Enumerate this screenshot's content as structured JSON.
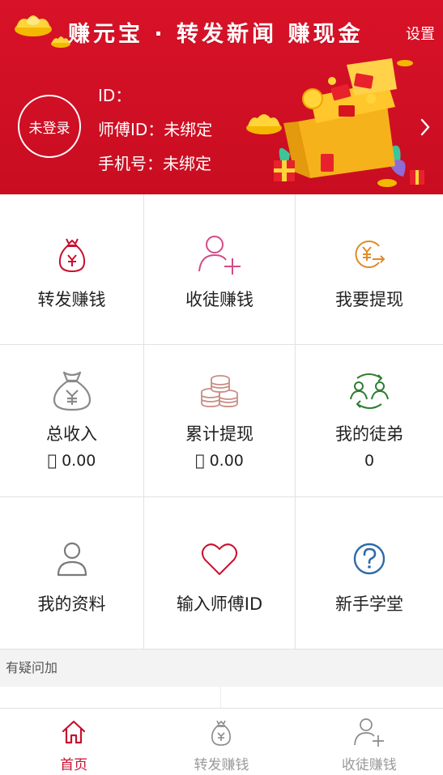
{
  "header": {
    "slogan": "赚元宝 · 转发新闻 赚现金",
    "settings_label": "设置",
    "avatar_label": "未登录",
    "id_line": "ID：",
    "master_id_line": "师傅ID：未绑定",
    "phone_line": "手机号：未绑定",
    "accent_color": "#d81228"
  },
  "grid": {
    "share_earn": {
      "label": "转发赚钱",
      "icon": "money-bag-icon"
    },
    "recruit_earn": {
      "label": "收徒赚钱",
      "icon": "add-user-icon"
    },
    "withdraw": {
      "label": "我要提现",
      "icon": "yuan-transfer-icon"
    },
    "total_income": {
      "label": "总收入",
      "value": "\u0000 0.00",
      "icon": "money-sack-icon"
    },
    "total_withdrawn": {
      "label": "累计提现",
      "value": "\u0000 0.00",
      "icon": "coin-stack-icon"
    },
    "my_apprentices": {
      "label": "我的徒弟",
      "value": "0",
      "icon": "people-exchange-icon"
    },
    "my_profile": {
      "label": "我的资料",
      "icon": "user-icon"
    },
    "enter_master_id": {
      "label": "输入师傅ID",
      "icon": "heart-icon"
    },
    "beginner_school": {
      "label": "新手学堂",
      "icon": "question-circle-icon"
    }
  },
  "question_bar": {
    "text": "有疑问加"
  },
  "tabbar": {
    "home": {
      "label": "首页",
      "icon": "home-icon"
    },
    "share": {
      "label": "转发赚钱",
      "icon": "money-bag-icon"
    },
    "recruit": {
      "label": "收徒赚钱",
      "icon": "add-user-icon"
    },
    "active_color": "#c8102e",
    "inactive_color": "#9a9a9a"
  }
}
